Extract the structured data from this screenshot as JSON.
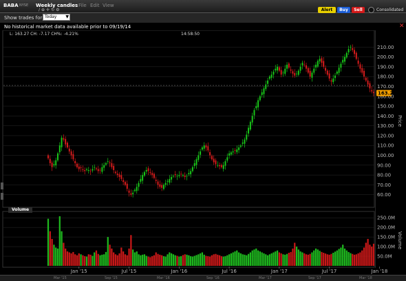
{
  "window": {
    "symbol": "BABA",
    "exchange": "NYSE",
    "title": "Weekly candles",
    "menus": [
      "File",
      "Edit",
      "View"
    ],
    "buttons": [
      {
        "label": "Alert",
        "color": "#e8d000",
        "text_color": "#000000"
      },
      {
        "label": "Buy",
        "color": "#1d5fd8",
        "text_color": "#ffffff"
      },
      {
        "label": "Sell",
        "color": "#d41a1a",
        "text_color": "#ffffff"
      }
    ],
    "consolidated_label": "Consolidated"
  },
  "controls": {
    "show_trades_label": "Show trades for:",
    "show_trades_value": "Today"
  },
  "notice": "No historical market data available prior to 09/19/14",
  "legend": {
    "last": "L: 163.27  CH: -7.17  CH%: -4.21%",
    "time": "14:58:50"
  },
  "price_badge": "163.27",
  "volume_label": "Volume",
  "mini_scroll_labels": [
    "Mar '15",
    "Sep '15",
    "Mar '16",
    "Sep '16",
    "Mar '17",
    "Sep '17",
    "Mar '18"
  ],
  "colors": {
    "up": "#19c819",
    "down": "#d81c1c",
    "volume_up": "#1eb81e",
    "volume_down": "#c81818",
    "badge": "#f5a000",
    "grid": "#2a2a2a",
    "axis_text": "#bbbbbb"
  },
  "chart_data": {
    "type": "candlestick",
    "interval": "weekly",
    "x_tick_labels": [
      "Jan '15",
      "Jul '15",
      "Jan '16",
      "Jul '16",
      "Jan '17",
      "Jul '17",
      "Jan '18",
      "Jul '18"
    ],
    "x_tick_weeks": [
      16,
      42,
      68,
      94,
      120,
      146,
      172,
      198
    ],
    "y_tick_labels": [
      "60.00",
      "70.00",
      "80.00",
      "90.00",
      "100.00",
      "110.00",
      "120.00",
      "130.00",
      "140.00",
      "150.00",
      "160.00",
      "170.00",
      "180.00",
      "190.00",
      "200.00",
      "210.00"
    ],
    "y_tick_values": [
      60,
      70,
      80,
      90,
      100,
      110,
      120,
      130,
      140,
      150,
      160,
      170,
      180,
      190,
      200,
      210
    ],
    "ylabel": "Price",
    "ylim": [
      50,
      220
    ],
    "reference_line": 171,
    "last_price": 163.27,
    "closes": [
      97,
      92,
      88,
      91,
      95,
      102,
      110,
      118,
      116,
      111,
      108,
      104,
      100,
      96,
      92,
      88,
      86,
      87,
      85,
      84,
      86,
      85,
      84,
      86,
      88,
      86,
      84,
      85,
      88,
      90,
      92,
      94,
      92,
      88,
      85,
      82,
      80,
      78,
      76,
      73,
      70,
      66,
      62,
      60,
      62,
      65,
      68,
      72,
      76,
      80,
      83,
      85,
      84,
      82,
      80,
      77,
      74,
      70,
      68,
      67,
      70,
      72,
      74,
      76,
      78,
      79,
      80,
      79,
      80,
      81,
      80,
      78,
      79,
      82,
      84,
      88,
      92,
      96,
      100,
      104,
      108,
      110,
      108,
      105,
      100,
      96,
      93,
      91,
      90,
      89,
      88,
      90,
      94,
      98,
      102,
      103,
      104,
      105,
      106,
      108,
      110,
      113,
      116,
      121,
      128,
      134,
      140,
      146,
      150,
      156,
      160,
      164,
      168,
      172,
      176,
      180,
      182,
      185,
      188,
      190,
      186,
      182,
      184,
      188,
      192,
      189,
      186,
      183,
      181,
      183,
      186,
      190,
      194,
      192,
      188,
      184,
      180,
      184,
      188,
      192,
      196,
      198,
      194,
      190,
      186,
      182,
      178,
      175,
      178,
      181,
      185,
      189,
      193,
      197,
      200,
      204,
      208,
      210,
      207,
      203,
      198,
      193,
      188,
      184,
      180,
      176,
      172,
      168,
      165,
      163.27
    ],
    "volume_ylabel": "Volume",
    "volume_y_tick_labels": [
      "50.0M",
      "100.0M",
      "150.0M",
      "200.0M",
      "250.0M"
    ],
    "volume_y_tick_values": [
      50,
      100,
      150,
      200,
      250
    ],
    "volume_ylim": [
      0,
      265
    ],
    "volumes": [
      245,
      180,
      140,
      110,
      95,
      90,
      258,
      180,
      120,
      90,
      75,
      70,
      65,
      72,
      60,
      55,
      65,
      60,
      55,
      50,
      48,
      60,
      58,
      52,
      70,
      80,
      62,
      55,
      58,
      60,
      72,
      150,
      110,
      90,
      70,
      60,
      55,
      65,
      95,
      75,
      60,
      55,
      90,
      160,
      85,
      70,
      75,
      60,
      55,
      58,
      60,
      52,
      48,
      45,
      50,
      55,
      70,
      62,
      58,
      55,
      50,
      48,
      60,
      70,
      65,
      60,
      55,
      52,
      48,
      50,
      56,
      60,
      58,
      55,
      50,
      48,
      52,
      56,
      60,
      65,
      70,
      58,
      52,
      50,
      48,
      55,
      60,
      62,
      58,
      55,
      50,
      48,
      50,
      55,
      60,
      65,
      70,
      75,
      80,
      70,
      65,
      60,
      58,
      55,
      62,
      70,
      80,
      85,
      90,
      80,
      75,
      70,
      65,
      60,
      55,
      60,
      65,
      70,
      75,
      80,
      70,
      65,
      60,
      58,
      62,
      68,
      72,
      90,
      120,
      100,
      85,
      75,
      70,
      65,
      60,
      58,
      62,
      70,
      80,
      90,
      85,
      78,
      72,
      68,
      64,
      60,
      58,
      62,
      68,
      74,
      80,
      88,
      95,
      110,
      90,
      80,
      72,
      66,
      62,
      58,
      60,
      65,
      70,
      80,
      95,
      120,
      140,
      110,
      100,
      115
    ]
  }
}
